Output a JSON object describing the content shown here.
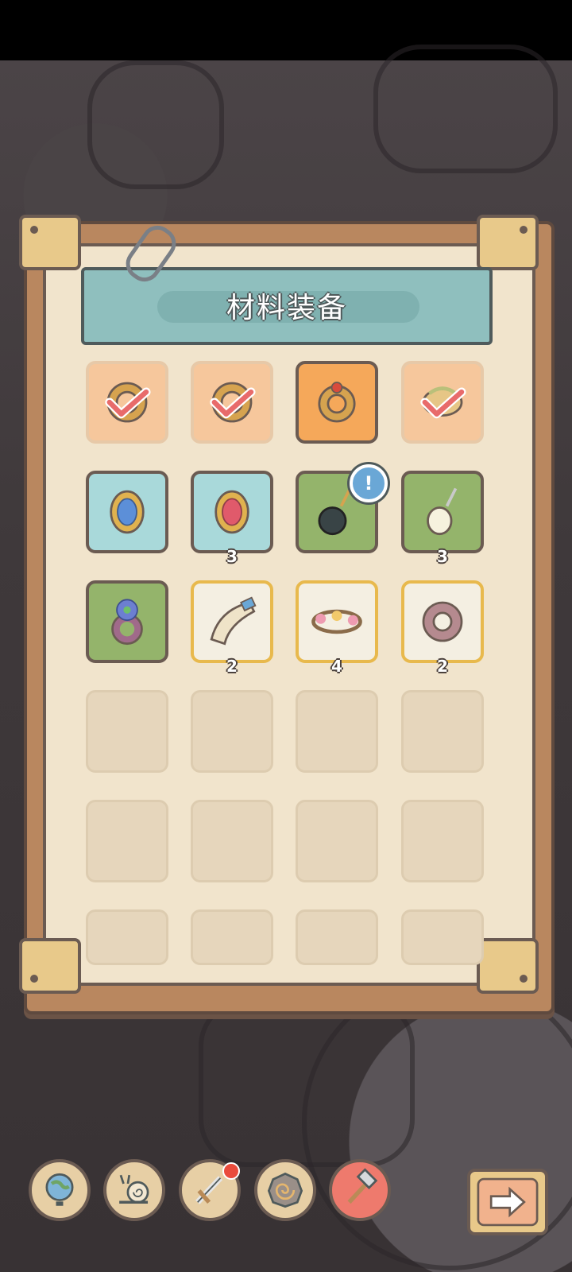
{
  "colors": {
    "panel_wood": "#b9875f",
    "paper": "#f1e4cc",
    "banner": "#8fbfbe",
    "slot_orange": "#f6c79c",
    "slot_orange_active": "#f5a85a",
    "slot_blue": "#a9d9da",
    "slot_green": "#94b46b",
    "slot_white": "#f4efe2",
    "slot_empty": "#e6d6bc",
    "alert": "#6aa7d6"
  },
  "panel": {
    "title": "材料装备"
  },
  "items": [
    {
      "name": "ring-checked-icon",
      "slot": "orange",
      "count": "",
      "checked": true
    },
    {
      "name": "ring-checked-icon",
      "slot": "orange",
      "count": "",
      "checked": true
    },
    {
      "name": "ruby-ring-icon",
      "slot": "orange-active",
      "count": "",
      "checked": false
    },
    {
      "name": "feather-ring-checked-icon",
      "slot": "orange",
      "count": "",
      "checked": true
    },
    {
      "name": "sapphire-brooch-icon",
      "slot": "blue",
      "count": "",
      "checked": false
    },
    {
      "name": "ruby-brooch-icon",
      "slot": "blue",
      "count": "3",
      "checked": false
    },
    {
      "name": "black-pearl-pendant-icon",
      "slot": "green",
      "count": "",
      "checked": false,
      "alert": "!"
    },
    {
      "name": "white-pearl-pendant-icon",
      "slot": "green",
      "count": "3",
      "checked": false
    },
    {
      "name": "flower-ring-icon",
      "slot": "green",
      "count": "",
      "checked": false
    },
    {
      "name": "horn-icon",
      "slot": "white",
      "count": "2",
      "checked": false
    },
    {
      "name": "flower-wreath-icon",
      "slot": "white",
      "count": "4",
      "checked": false
    },
    {
      "name": "stone-ring-icon",
      "slot": "white",
      "count": "2",
      "checked": false
    }
  ],
  "dock": [
    {
      "name": "globe-icon"
    },
    {
      "name": "snail-icon"
    },
    {
      "name": "sword-icon",
      "notification": true
    },
    {
      "name": "spiral-shell-icon"
    },
    {
      "name": "hammer-icon"
    }
  ],
  "next_button": {
    "name": "arrow-right-icon"
  }
}
